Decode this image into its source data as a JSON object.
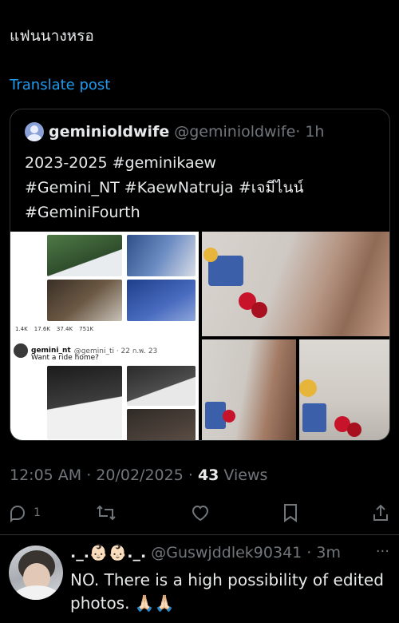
{
  "post": {
    "text": "แฟนนางหรอ",
    "translate_label": "Translate post"
  },
  "quoted": {
    "name": "geminioldwife",
    "handle": "@geminioldwife",
    "time": "· 1h",
    "text_line1": "2023-2025 #geminikaew",
    "text_line2": "#Gemini_NT #KaewNatruja #เจมีไนน์",
    "text_line3": "#GeminiFourth",
    "screenshot": {
      "stats": [
        "1.4K",
        "17.6K",
        "37.4K",
        "751K"
      ],
      "user_name": "gemini_nt",
      "user_meta": "@gemini_ti · 22 ก.พ. 23",
      "text": "Want a ride home?"
    }
  },
  "meta": {
    "time": "12:05 AM · 20/02/2025 · ",
    "views_count": "43",
    "views_label": " Views"
  },
  "actions": {
    "reply_count": "1",
    "icons": [
      "reply-icon",
      "retweet-icon",
      "like-icon",
      "bookmark-icon",
      "share-icon"
    ]
  },
  "reply": {
    "name": "._.👶🏻👶🏻._.",
    "handle": " @Guswjddlek90341 · 3m",
    "text": "NO. There is a high possibility of edited photos. 🙏🏻🙏🏻",
    "more": "···"
  },
  "colors": {
    "background": "#000000",
    "accent": "#1d9bf0",
    "muted": "#71767b",
    "border": "#2f3336"
  }
}
